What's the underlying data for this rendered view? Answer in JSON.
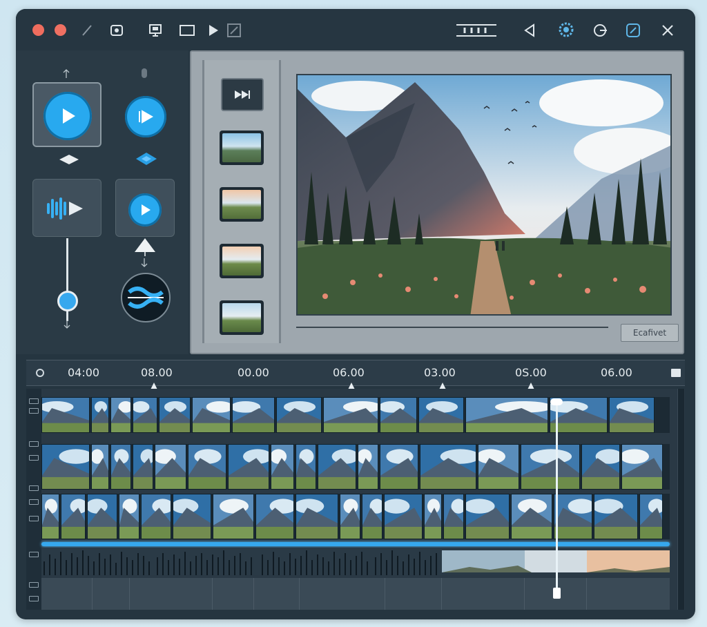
{
  "titlebar": {
    "window_controls": [
      "close",
      "minimize"
    ],
    "left_icons": [
      "pencil-icon",
      "record-icon",
      "monitor-icon",
      "rectangle-icon",
      "play-icon",
      "crop-icon"
    ],
    "right_icons": [
      "slider-ruler-icon",
      "back-triangle-icon",
      "settings-gear-icon",
      "refresh-icon",
      "edit-icon",
      "close-icon"
    ]
  },
  "tools": {
    "items": [
      "play-tool",
      "fast-play-tool",
      "audio-play-tool",
      "preview-play-tool",
      "volume-slider",
      "split-tool"
    ]
  },
  "preview": {
    "skip_icon": "skip-forward-icon",
    "thumbnails": 4,
    "effect_button_label": "Ecafivet"
  },
  "timeline": {
    "ruler_labels": [
      "04:00",
      "08.00",
      "00.00",
      "06.00",
      "03.00",
      "0S.00",
      "06.00"
    ],
    "track_rows": 3,
    "colors": {
      "accent": "#36a8ee",
      "window_bg": "#253540",
      "preview_bg": "#9ea7ae"
    }
  }
}
